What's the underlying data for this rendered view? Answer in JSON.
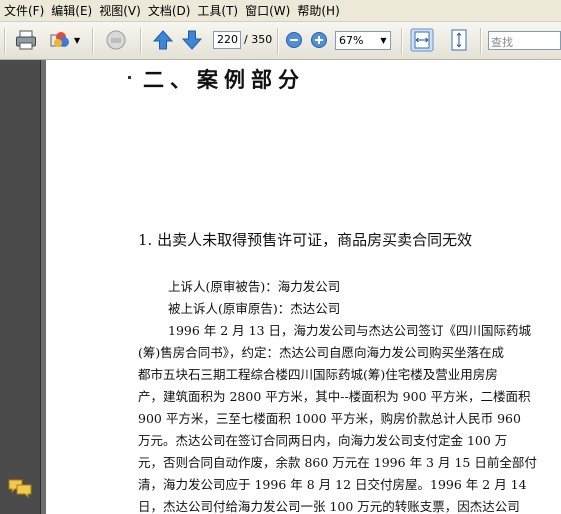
{
  "menu": [
    "文件(F)",
    "编辑(E)",
    "视图(V)",
    "文档(D)",
    "工具(T)",
    "窗口(W)",
    "帮助(H)"
  ],
  "toolbar": {
    "page_current": "220",
    "page_total": "/ 350",
    "zoom": "67%",
    "search_placeholder": "查找"
  },
  "document": {
    "section_title": "二、案例部分",
    "case_title": "1. 出卖人未取得预售许可证，商品房买卖合同无效",
    "appellant": "上诉人(原审被告)：海力发公司",
    "appellee": "被上诉人(原审原告)：杰达公司",
    "paragraph_lines": [
      "1996 年 2 月 13 日，海力发公司与杰达公司签订《四川国际药城",
      "(筹)售房合同书》，约定：杰达公司自愿向海力发公司购买坐落在成",
      "都市五块石三期工程综合楼四川国际药城(筹)住宅楼及营业用房房",
      "产，建筑面积为 2800 平方米，其中--楼面积为 900 平方米，二楼面积",
      "900 平方米，三至七楼面积 1000 平方米，购房价款总计人民币 960",
      "万元。杰达公司在签订合同两日内，向海力发公司支付定金 100 万",
      "元，否则合同自动作废，余款 860 万元在 1996 年 3 月 15 日前全部付",
      "清，海力发公司应于 1996 年 8 月 12 日交付房屋。1996 年 2 月 14",
      "日，杰达公司付给海力发公司一张 100 万元的转账支票，因杰达公司"
    ]
  }
}
